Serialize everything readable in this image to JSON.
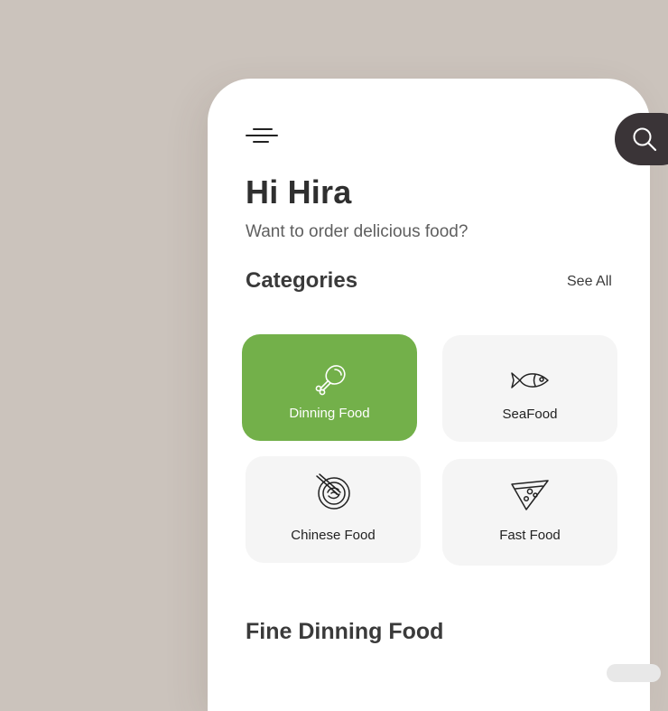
{
  "header": {
    "greeting": "Hi Hira",
    "subtitle": "Want to order delicious food?"
  },
  "categories": {
    "title": "Categories",
    "see_all": "See All",
    "items": [
      {
        "label": "Dinning Food",
        "icon": "chicken-leg-icon",
        "active": true
      },
      {
        "label": "SeaFood",
        "icon": "fish-icon",
        "active": false
      },
      {
        "label": "Chinese Food",
        "icon": "noodle-bowl-icon",
        "active": false
      },
      {
        "label": "Fast Food",
        "icon": "pizza-slice-icon",
        "active": false
      }
    ]
  },
  "fine_dining": {
    "title": "Fine Dinning Food"
  },
  "colors": {
    "background": "#cbc3bc",
    "accent": "#73b04a",
    "search_button": "#3a3437",
    "card": "#f5f5f5"
  }
}
